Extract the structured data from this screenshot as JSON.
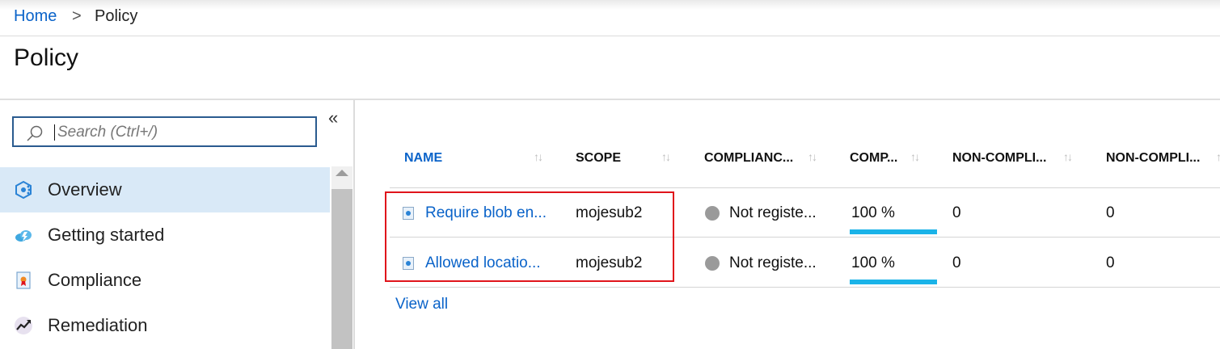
{
  "breadcrumb": {
    "home": "Home",
    "separator": ">",
    "current": "Policy"
  },
  "page": {
    "title": "Policy"
  },
  "sidebar": {
    "collapse_glyph": "«",
    "search_placeholder": "Search (Ctrl+/)",
    "items": [
      {
        "label": "Overview",
        "icon": "overview-icon",
        "active": true
      },
      {
        "label": "Getting started",
        "icon": "cloud-icon",
        "active": false
      },
      {
        "label": "Compliance",
        "icon": "compliance-icon",
        "active": false
      },
      {
        "label": "Remediation",
        "icon": "remediation-icon",
        "active": false
      }
    ]
  },
  "table": {
    "sort_glyph": "↑↓",
    "headers": [
      "NAME",
      "SCOPE",
      "COMPLIANC...",
      "COMP...",
      "NON-COMPLI...",
      "NON-COMPLI..."
    ],
    "rows": [
      {
        "name": "Require blob en...",
        "scope": "mojesub2",
        "compliance": "Not registe...",
        "comp": "100 %",
        "comp_fraction": 1.0,
        "noncompliant_a": "0",
        "noncompliant_b": "0"
      },
      {
        "name": "Allowed locatio...",
        "scope": "mojesub2",
        "compliance": "Not registe...",
        "comp": "100 %",
        "comp_fraction": 1.0,
        "noncompliant_a": "0",
        "noncompliant_b": "0"
      }
    ],
    "view_all": "View all"
  },
  "colors": {
    "link": "#0a63c9",
    "active_nav": "#d9e9f7",
    "compliance_bar": "#1ab3e8",
    "status_grey": "#9a9a9a",
    "highlight": "#e0141b"
  }
}
